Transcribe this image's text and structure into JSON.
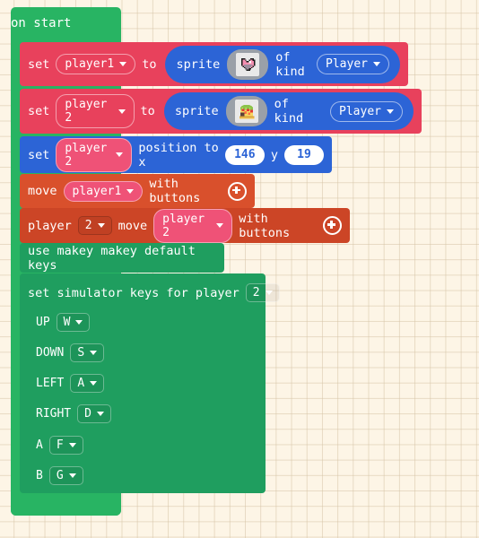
{
  "workspace": {
    "background_color": "#fdf5e6",
    "grid_color": "#d6c4a6"
  },
  "blocks": {
    "on_start": {
      "label": "on start",
      "color": "#28b463"
    },
    "set_player1_sprite": {
      "set_label": "set",
      "variable": "player1",
      "to_label": "to",
      "sprite_label": "sprite",
      "sprite_icon": "heart-sprite-icon",
      "of_kind_label": "of kind",
      "kind": "Player",
      "color": "#e8415c",
      "reporter_color": "#2c64d6"
    },
    "set_player2_sprite": {
      "set_label": "set",
      "variable": "player 2",
      "to_label": "to",
      "sprite_label": "sprite",
      "sprite_icon": "taco-sprite-icon",
      "of_kind_label": "of kind",
      "kind": "Player",
      "color": "#e8415c",
      "reporter_color": "#2c64d6"
    },
    "set_position": {
      "set_label": "set",
      "variable": "player 2",
      "position_label": "position to x",
      "x_value": "146",
      "y_label": "y",
      "y_value": "19",
      "color": "#2c64d6"
    },
    "move_player1": {
      "move_label": "move",
      "variable": "player1",
      "with_buttons_label": "with buttons",
      "expand_icon": "plus-circle-icon",
      "color": "#d9502c"
    },
    "player2_move": {
      "player_label": "player",
      "player_number": "2",
      "move_label": "move",
      "variable": "player 2",
      "with_buttons_label": "with buttons",
      "expand_icon": "plus-circle-icon",
      "color": "#cc4526"
    },
    "makey_makey": {
      "label": "use makey makey default keys",
      "color": "#1f9e5f"
    },
    "simulator_keys": {
      "label": "set simulator keys for player",
      "player_number": "2",
      "color": "#1f9e5f",
      "mappings": [
        {
          "direction": "UP",
          "key": "W"
        },
        {
          "direction": "DOWN",
          "key": "S"
        },
        {
          "direction": "LEFT",
          "key": "A"
        },
        {
          "direction": "RIGHT",
          "key": "D"
        },
        {
          "direction": "A",
          "key": "F"
        },
        {
          "direction": "B",
          "key": "G"
        }
      ]
    }
  }
}
